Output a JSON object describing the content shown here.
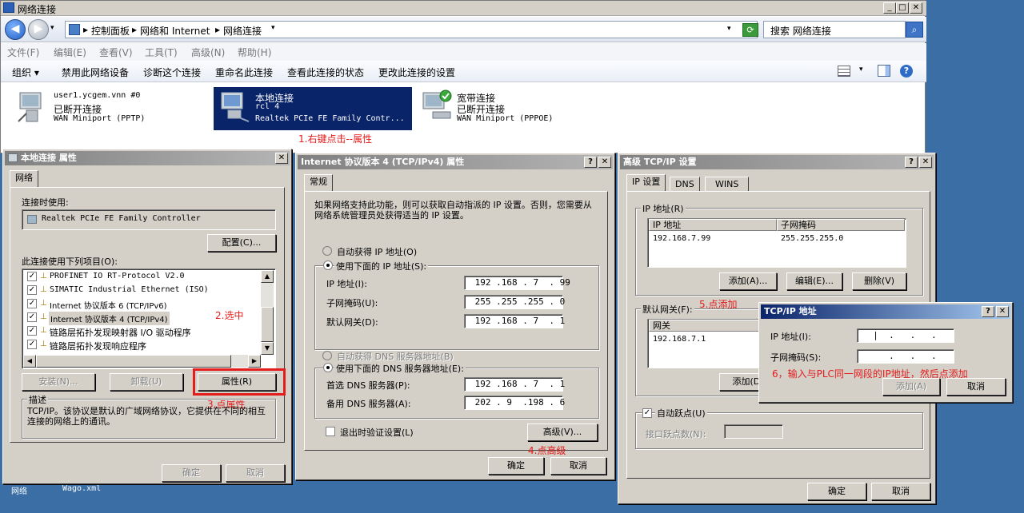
{
  "explorer": {
    "title": "网络连接",
    "address": [
      "控制面板",
      "网络和 Internet",
      "网络连接"
    ],
    "search_placeholder": "搜索 网络连接",
    "menu": [
      "文件(F)",
      "编辑(E)",
      "查看(V)",
      "工具(T)",
      "高级(N)",
      "帮助(H)"
    ],
    "toolbar": [
      "组织 ▾",
      "禁用此网络设备",
      "诊断这个连接",
      "重命名此连接",
      "查看此连接的状态",
      "更改此连接的设置"
    ],
    "connections": [
      {
        "name": "user1.ycgem.vnn #0",
        "status": "已断开连接",
        "device": "WAN Miniport (PPTP)"
      },
      {
        "name": "本地连接",
        "status": "rcl  4",
        "device": "Realtek PCIe FE Family Contr..."
      },
      {
        "name": "宽带连接",
        "status": "已断开连接",
        "device": "WAN Miniport (PPPOE)"
      }
    ],
    "annotation_1": "1.右键点击--属性"
  },
  "props": {
    "title": "本地连接 属性",
    "tab": "网络",
    "connect_using_label": "连接时使用:",
    "adapter": "Realtek PCIe FE Family Controller",
    "configure_btn": "配置(C)...",
    "items_label": "此连接使用下列项目(O):",
    "items": [
      "PROFINET IO RT-Protocol V2.0",
      "SIMATIC Industrial Ethernet (ISO)",
      "Internet 协议版本 6 (TCP/IPv6)",
      "Internet 协议版本 4 (TCP/IPv4)",
      "链路层拓扑发现映射器 I/O 驱动程序",
      "链路层拓扑发现响应程序"
    ],
    "install_btn": "安装(N)...",
    "uninstall_btn": "卸载(U)",
    "properties_btn": "属性(R)",
    "desc_label": "描述",
    "desc_text": "TCP/IP。该协议是默认的广域网络协议，它提供在不同的相互连接的网络上的通讯。",
    "ok_btn": "确定",
    "cancel_btn": "取消",
    "annotation_2": "2.选中",
    "annotation_3": "3.点属性"
  },
  "ipv4": {
    "title": "Internet 协议版本 4 (TCP/IPv4) 属性",
    "tab": "常规",
    "intro": "如果网络支持此功能，则可以获取自动指派的 IP 设置。否则，您需要从网络系统管理员处获得适当的 IP 设置。",
    "auto_ip": "自动获得 IP 地址(O)",
    "manual_ip": "使用下面的 IP 地址(S):",
    "ip_label": "IP 地址(I):",
    "ip_value": " 192 .168 . 7  . 99",
    "mask_label": "子网掩码(U):",
    "mask_value": " 255 .255 .255 . 0",
    "gw_label": "默认网关(D):",
    "gw_value": " 192 .168 . 7  . 1",
    "auto_dns": "自动获得 DNS 服务器地址(B)",
    "manual_dns": "使用下面的 DNS 服务器地址(E):",
    "dns1_label": "首选 DNS 服务器(P):",
    "dns1_value": " 192 .168 . 7  . 1",
    "dns2_label": "备用 DNS 服务器(A):",
    "dns2_value": " 202 . 9  .198 . 6",
    "validate": "退出时验证设置(L)",
    "advanced_btn": "高级(V)...",
    "ok_btn": "确定",
    "cancel_btn": "取消",
    "annotation_4": "4.点高级"
  },
  "advanced": {
    "title": "高级 TCP/IP 设置",
    "tabs": [
      "IP 设置",
      "DNS",
      "WINS"
    ],
    "ip_group": "IP 地址(R)",
    "col_ip": "IP 地址",
    "col_mask": "子网掩码",
    "row_ip": "192.168.7.99",
    "row_mask": "255.255.255.0",
    "add_btn": "添加(A)...",
    "edit_btn": "编辑(E)...",
    "del_btn": "删除(V)",
    "gw_group": "默认网关(F):",
    "gw_col": "网关",
    "gw_row": "192.168.7.1",
    "gw_add_btn": "添加(D)",
    "auto_metric": "自动跃点(U)",
    "iface_metric": "接口跃点数(N):",
    "ok_btn": "确定",
    "cancel_btn": "取消",
    "annotation_5": "5.点添加"
  },
  "addr": {
    "title": "TCP/IP 地址",
    "ip_label": "IP 地址(I):",
    "ip_value": "  |  .   .   .",
    "mask_label": "子网掩码(S):",
    "mask_value": "     .   .   .",
    "add_btn": "添加(A)",
    "cancel_btn": "取消",
    "annotation_6": "6，输入与PLC同一网段的IP地址，然后点添加"
  },
  "desktop": {
    "icon1": "网络",
    "icon2": "Wago.xml"
  }
}
